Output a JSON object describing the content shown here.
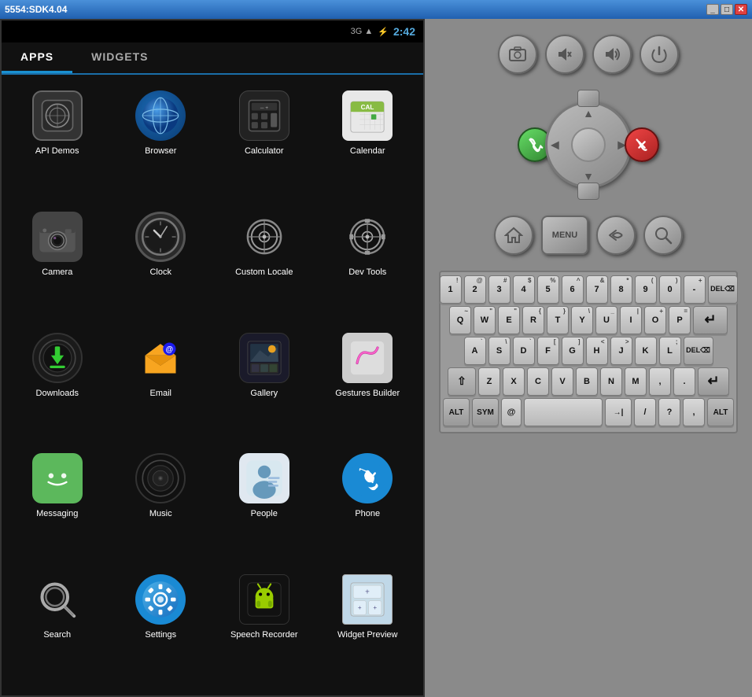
{
  "titleBar": {
    "title": "5554:SDK4.04",
    "minimizeLabel": "_",
    "maximizeLabel": "□",
    "closeLabel": "✕"
  },
  "statusBar": {
    "signal": "3G",
    "time": "2:42"
  },
  "tabs": [
    {
      "label": "APPS",
      "active": true
    },
    {
      "label": "WIDGETS",
      "active": false
    }
  ],
  "apps": [
    {
      "id": "api-demos",
      "label": "API Demos"
    },
    {
      "id": "browser",
      "label": "Browser"
    },
    {
      "id": "calculator",
      "label": "Calculator"
    },
    {
      "id": "calendar",
      "label": "Calendar"
    },
    {
      "id": "camera",
      "label": "Camera"
    },
    {
      "id": "clock",
      "label": "Clock"
    },
    {
      "id": "custom-locale",
      "label": "Custom\nLocale"
    },
    {
      "id": "dev-tools",
      "label": "Dev Tools"
    },
    {
      "id": "downloads",
      "label": "Downloads"
    },
    {
      "id": "email",
      "label": "Email"
    },
    {
      "id": "gallery",
      "label": "Gallery"
    },
    {
      "id": "gestures-builder",
      "label": "Gestures\nBuilder"
    },
    {
      "id": "messaging",
      "label": "Messaging"
    },
    {
      "id": "music",
      "label": "Music"
    },
    {
      "id": "people",
      "label": "People"
    },
    {
      "id": "phone",
      "label": "Phone"
    },
    {
      "id": "search",
      "label": "Search"
    },
    {
      "id": "settings",
      "label": "Settings"
    },
    {
      "id": "speech-recorder",
      "label": "Speech\nRecorder"
    },
    {
      "id": "widget-preview",
      "label": "Widget\nPreview"
    }
  ],
  "keyboard": {
    "rows": [
      [
        "!",
        "@",
        "#",
        "$",
        "%",
        "^",
        "&",
        "*",
        "(",
        ")",
        "-"
      ],
      [
        "1",
        "2",
        "3",
        "4",
        "5",
        "6",
        "7",
        "8",
        "9",
        "0",
        "="
      ],
      [
        "Q",
        "W",
        "E",
        "R",
        "T",
        "Y",
        "U",
        "I",
        "O",
        "P",
        "DEL"
      ],
      [
        "A",
        "S",
        "D",
        "F",
        "G",
        "H",
        "J",
        "K",
        "L",
        ";",
        "'"
      ],
      [
        "⇧",
        "Z",
        "X",
        "C",
        "V",
        "B",
        "N",
        "M",
        ",",
        ".",
        "↵"
      ],
      [
        "ALT",
        "SYM",
        "@",
        "SPACE",
        "→|",
        "/",
        "?",
        ",",
        "ALT"
      ]
    ]
  }
}
